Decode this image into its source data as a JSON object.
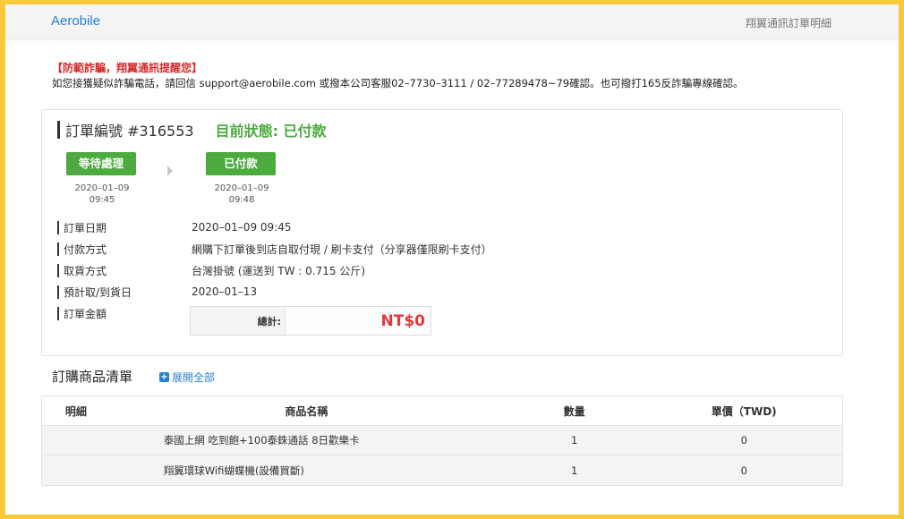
{
  "header": {
    "brand": "Aerobile",
    "page_link": "翔翼通訊訂單明細"
  },
  "notice": {
    "title": "【防範詐騙，翔翼通訊提醒您】",
    "text": "如您接獲疑似詐騙電話，請回信 support@aerobile.com 或撥本公司客服02–7730–3111 / 02–77289478~79確認。也可撥打165反詐騙專線確認。"
  },
  "order": {
    "number_label": "訂單編號 #316553",
    "status_label": "目前狀態: 已付款",
    "steps": [
      {
        "label": "等待處理",
        "date": "2020–01–09",
        "time": "09:45"
      },
      {
        "label": "已付款",
        "date": "2020–01–09",
        "time": "09:48"
      }
    ],
    "info": [
      {
        "label": "訂單日期",
        "value": "2020–01–09 09:45"
      },
      {
        "label": "付款方式",
        "value": "網購下訂單後到店自取付現 / 刷卡支付（分享器僅限刷卡支付）"
      },
      {
        "label": "取貨方式",
        "value": "台灣掛號 (運送到 TW : 0.715 公斤)"
      },
      {
        "label": "預計取/到貨日",
        "value": "2020–01–13"
      },
      {
        "label": "訂單金額",
        "value": ""
      }
    ],
    "total_label": "總計:",
    "total_value": "NT$0"
  },
  "items_section": {
    "title": "訂購商品清單",
    "expand_icon": "plus-square-icon",
    "expand_label": "展開全部"
  },
  "table": {
    "headers": [
      "明細",
      "商品名稱",
      "數量",
      "單價（TWD)"
    ],
    "rows": [
      {
        "detail": "",
        "name": "泰國上網 吃到飽+100泰銖通話 8日歡樂卡",
        "qty": "1",
        "price": "0"
      },
      {
        "detail": "",
        "name": "翔翼環球Wifi蝴蝶機(設備買斷)",
        "qty": "1",
        "price": "0"
      }
    ]
  },
  "colors": {
    "accent_blue": "#2a7fd4",
    "status_green": "#4caa3f",
    "warning_red": "#d62b2b",
    "price_red": "#e03a3a",
    "frame_yellow": "#f9c93b"
  }
}
